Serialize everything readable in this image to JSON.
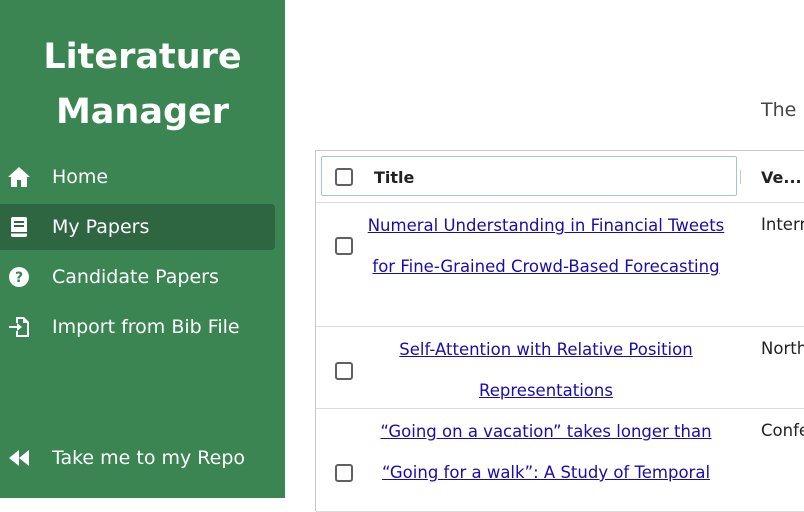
{
  "app": {
    "title_line1": "Literature",
    "title_line2": "Manager"
  },
  "nav": [
    {
      "label": "Home",
      "icon": "home-icon"
    },
    {
      "label": "My Papers",
      "icon": "book-icon",
      "active": true
    },
    {
      "label": "Candidate Papers",
      "icon": "question-circle-icon"
    },
    {
      "label": "Import from Bib File",
      "icon": "file-import-icon"
    },
    {
      "label": "Take me to my Repo",
      "icon": "backward-icon"
    }
  ],
  "main": {
    "description": "The p"
  },
  "table": {
    "columns": {
      "title": "Title",
      "venue": "Ve..."
    },
    "rows": [
      {
        "title_line1": "Numeral Understanding in Financial Tweets",
        "title_line2": "for Fine-Grained Crowd-Based Forecasting",
        "venue": "Intern"
      },
      {
        "title_line1": "Self-Attention with Relative Position",
        "title_line2": "Representations",
        "venue": "North"
      },
      {
        "title_line1": "“Going on a vacation” takes longer than",
        "title_line2": "“Going for a walk”: A Study of Temporal",
        "venue": "Confe"
      }
    ]
  },
  "colors": {
    "sidebar": "#3a8552",
    "sidebar_active": "#2e6642",
    "link": "#1a0dab"
  }
}
